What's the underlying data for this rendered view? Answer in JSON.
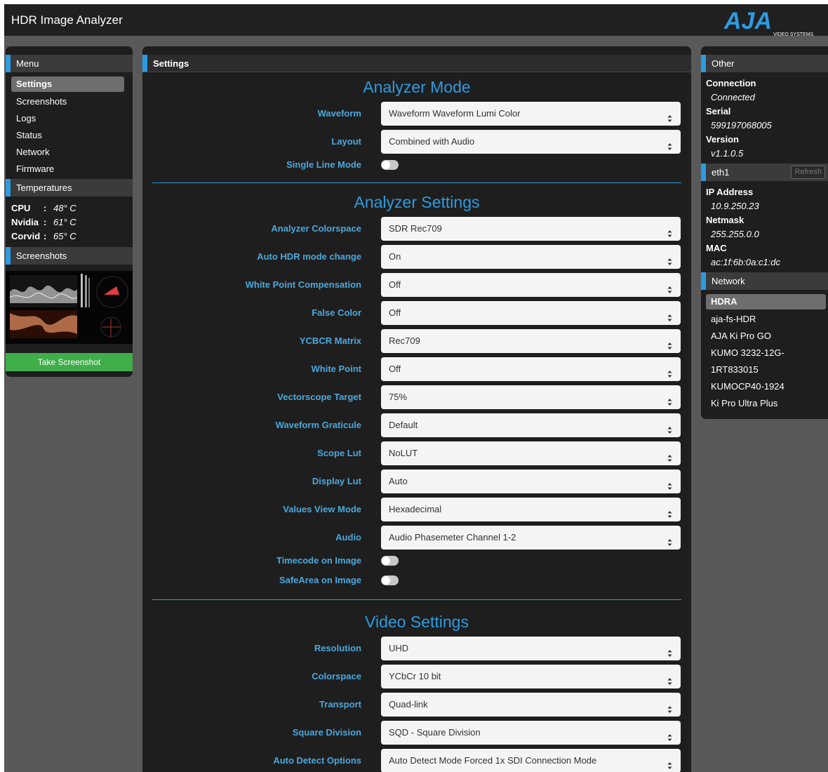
{
  "app": {
    "title": "HDR Image Analyzer",
    "logo_text": "AJA",
    "logo_subtext": "VIDEO SYSTEMS"
  },
  "colors": {
    "accent": "#2d9be0",
    "take_button": "#3fae49",
    "background": "#595959"
  },
  "left": {
    "menu_title": "Menu",
    "menu_items": [
      "Settings",
      "Screenshots",
      "Logs",
      "Status",
      "Network",
      "Firmware"
    ],
    "temps_title": "Temperatures",
    "temps": [
      {
        "name": "CPU",
        "value": "48° C"
      },
      {
        "name": "Nvidia",
        "value": "61° C"
      },
      {
        "name": "Corvid",
        "value": "65° C"
      }
    ],
    "screenshots_title": "Screenshots",
    "take_screenshot": "Take Screenshot"
  },
  "center": {
    "header": "Settings",
    "sections": [
      {
        "title": "Analyzer Mode",
        "fields": [
          {
            "label": "Waveform",
            "type": "select",
            "value": "Waveform Waveform Lumi Color"
          },
          {
            "label": "Layout",
            "type": "select",
            "value": "Combined with Audio"
          },
          {
            "label": "Single Line Mode",
            "type": "toggle",
            "value": "off"
          }
        ]
      },
      {
        "title": "Analyzer Settings",
        "fields": [
          {
            "label": "Analyzer Colorspace",
            "type": "select",
            "value": "SDR Rec709"
          },
          {
            "label": "Auto HDR mode change",
            "type": "select",
            "value": "On"
          },
          {
            "label": "White Point Compensation",
            "type": "select",
            "value": "Off"
          },
          {
            "label": "False Color",
            "type": "select",
            "value": "Off"
          },
          {
            "label": "YCBCR Matrix",
            "type": "select",
            "value": "Rec709"
          },
          {
            "label": "White Point",
            "type": "select",
            "value": "Off"
          },
          {
            "label": "Vectorscope Target",
            "type": "select",
            "value": "75%"
          },
          {
            "label": "Waveform Graticule",
            "type": "select",
            "value": "Default"
          },
          {
            "label": "Scope Lut",
            "type": "select",
            "value": "NoLUT"
          },
          {
            "label": "Display Lut",
            "type": "select",
            "value": "Auto"
          },
          {
            "label": "Values View Mode",
            "type": "select",
            "value": "Hexadecimal"
          },
          {
            "label": "Audio",
            "type": "select",
            "value": "Audio Phasemeter Channel 1-2"
          },
          {
            "label": "Timecode on Image",
            "type": "toggle",
            "value": "off"
          },
          {
            "label": "SafeArea on Image",
            "type": "toggle",
            "value": "off"
          }
        ]
      },
      {
        "title": "Video Settings",
        "fields": [
          {
            "label": "Resolution",
            "type": "select",
            "value": "UHD"
          },
          {
            "label": "Colorspace",
            "type": "select",
            "value": "YCbCr 10 bit"
          },
          {
            "label": "Transport",
            "type": "select",
            "value": "Quad-link"
          },
          {
            "label": "Square Division",
            "type": "select",
            "value": "SQD - Square Division"
          },
          {
            "label": "Auto Detect Options",
            "type": "select",
            "value": "Auto Detect Mode Forced 1x SDI Connection Mode"
          }
        ]
      }
    ]
  },
  "right": {
    "other_title": "Other",
    "other": [
      {
        "key": "Connection",
        "value": "Connected"
      },
      {
        "key": "Serial",
        "value": "599197068005"
      },
      {
        "key": "Version",
        "value": "v1.1.0.5"
      }
    ],
    "eth_title": "eth1",
    "refresh": "Refresh",
    "eth": [
      {
        "key": "IP Address",
        "value": "10.9.250.23"
      },
      {
        "key": "Netmask",
        "value": "255.255.0.0"
      },
      {
        "key": "MAC",
        "value": "ac:1f:6b:0a:c1:dc"
      }
    ],
    "network_title": "Network",
    "network_items": [
      "HDRA",
      "aja-fs-HDR",
      "AJA Ki Pro GO",
      "KUMO 3232-12G-1RT833015",
      "KUMOCP40-1924",
      "Ki Pro Ultra Plus"
    ]
  }
}
